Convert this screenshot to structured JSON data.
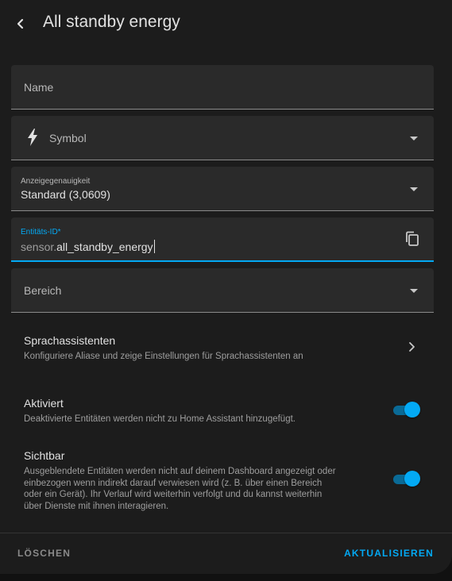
{
  "header": {
    "title": "All standby energy",
    "back_icon": "chevron-left-icon"
  },
  "fields": {
    "name": {
      "label": "Name",
      "value": ""
    },
    "symbol": {
      "label": "Symbol",
      "icon": "lightning-bolt-icon"
    },
    "precision": {
      "label": "Anzeigegenauigkeit",
      "value": "Standard (3,0609)"
    },
    "entity_id": {
      "label": "Entitäts-ID*",
      "prefix": "sensor.",
      "value": "all_standby_energy",
      "copy_icon": "copy-icon"
    },
    "area": {
      "label": "Bereich"
    }
  },
  "voice_assistants": {
    "title": "Sprachassistenten",
    "subtitle": "Konfiguriere Aliase und zeige Einstellungen für Sprachassistenten an"
  },
  "enabled": {
    "title": "Aktiviert",
    "subtitle": "Deaktivierte Entitäten werden nicht zu Home Assistant hinzugefügt.",
    "state": true
  },
  "visible": {
    "title": "Sichtbar",
    "subtitle_lines": [
      "Ausgeblendete Entitäten werden nicht auf deinem Dashboard angezeigt oder",
      "einbezogen wenn indirekt darauf verwiesen wird (z. B. über einen Bereich",
      "oder ein Gerät). Ihr Verlauf wird weiterhin verfolgt und du kannst weiterhin",
      "über Dienste mit ihnen interagieren."
    ],
    "state": true
  },
  "footer": {
    "delete_label": "LÖSCHEN",
    "update_label": "AKTUALISIEREN"
  },
  "colors": {
    "accent": "#03a9f4",
    "background": "#1c1c1c",
    "field": "#2a2a2a"
  }
}
